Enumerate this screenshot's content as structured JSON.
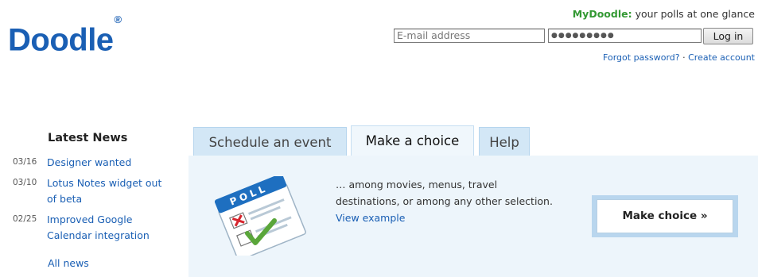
{
  "logo": {
    "text": "Doodle",
    "mark": "®"
  },
  "header": {
    "mydoodle_brand": "MyDoodle:",
    "mydoodle_tagline": "your polls at one glance",
    "email_placeholder": "E-mail address",
    "password_value": "●●●●●●●●●",
    "login_label": "Log in",
    "forgot_password": "Forgot password?",
    "separator": "·",
    "create_account": "Create account"
  },
  "news": {
    "title": "Latest News",
    "items": [
      {
        "date": "03/16",
        "text": "Designer wanted"
      },
      {
        "date": "03/10",
        "text": "Lotus Notes widget out of beta"
      },
      {
        "date": "02/25",
        "text": "Improved Google Calendar integration"
      }
    ],
    "all_news": "All news"
  },
  "tabs": [
    {
      "label": "Schedule an event",
      "active": false
    },
    {
      "label": "Make a choice",
      "active": true
    },
    {
      "label": "Help",
      "active": false
    }
  ],
  "panel": {
    "icon": "poll-checklist-icon",
    "description_line1": "… among movies, menus, travel",
    "description_line2": "destinations, or among any other selection.",
    "view_example": "View example",
    "button_label": "Make choice »"
  },
  "colors": {
    "brand_blue": "#1a5fb4",
    "mydoodle_green": "#339933",
    "panel_bg": "#edf5fb",
    "tab_bg": "#d3e7f6"
  }
}
